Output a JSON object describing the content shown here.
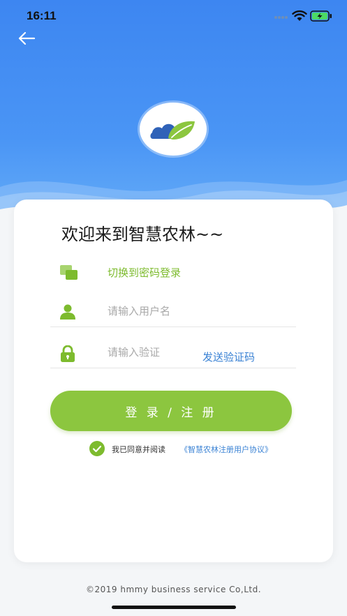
{
  "status_bar": {
    "time": "16:11"
  },
  "welcome": "欢迎来到智慧农林~~",
  "switch_login": "切换到密码登录",
  "username": {
    "placeholder": "请输入用户名",
    "value": ""
  },
  "code": {
    "placeholder": "请输入验证",
    "value": ""
  },
  "send_code": "发送验证码",
  "submit": "登 录 / 注 册",
  "agreement": {
    "text": "我已同意并阅读",
    "link": "《智慧农林注册用户协议》",
    "checked": true
  },
  "footer": "©2019 hmmy business service Co,Ltd.",
  "colors": {
    "header_blue": "#3d86f1",
    "accent_green": "#8cc63f",
    "link_blue": "#3a82d4"
  },
  "icons": [
    "back-arrow-icon",
    "logo",
    "switch-icon",
    "user-icon",
    "lock-icon",
    "check-icon"
  ]
}
